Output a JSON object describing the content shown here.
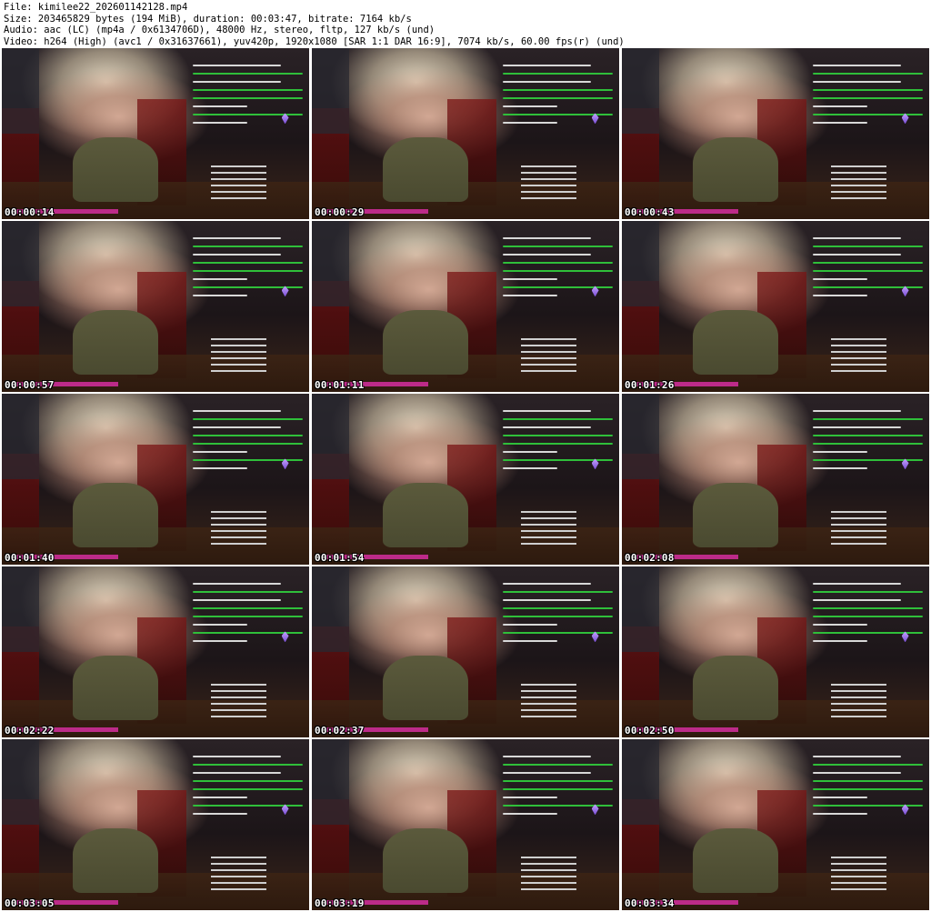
{
  "header": {
    "file_line": "File: kimilee22_202601142128.mp4",
    "size_line": "Size: 203465829 bytes (194 MiB), duration: 00:03:47, bitrate: 7164 kb/s",
    "audio_line": "Audio: aac (LC) (mp4a / 0x6134706D), 48000 Hz, stereo, fltp, 127 kb/s (und)",
    "video_line": "Video: h264 (High) (avc1 / 0x31637661), yuv420p, 1920x1080 [SAR 1:1 DAR 16:9], 7074 kb/s, 60.00 fps(r) (und)"
  },
  "thumbnails": [
    {
      "timestamp": "00:00:14"
    },
    {
      "timestamp": "00:00:29"
    },
    {
      "timestamp": "00:00:43"
    },
    {
      "timestamp": "00:00:57"
    },
    {
      "timestamp": "00:01:11"
    },
    {
      "timestamp": "00:01:26"
    },
    {
      "timestamp": "00:01:40"
    },
    {
      "timestamp": "00:01:54"
    },
    {
      "timestamp": "00:02:08"
    },
    {
      "timestamp": "00:02:22"
    },
    {
      "timestamp": "00:02:37"
    },
    {
      "timestamp": "00:02:50"
    },
    {
      "timestamp": "00:03:05"
    },
    {
      "timestamp": "00:03:19"
    },
    {
      "timestamp": "00:03:34"
    }
  ]
}
